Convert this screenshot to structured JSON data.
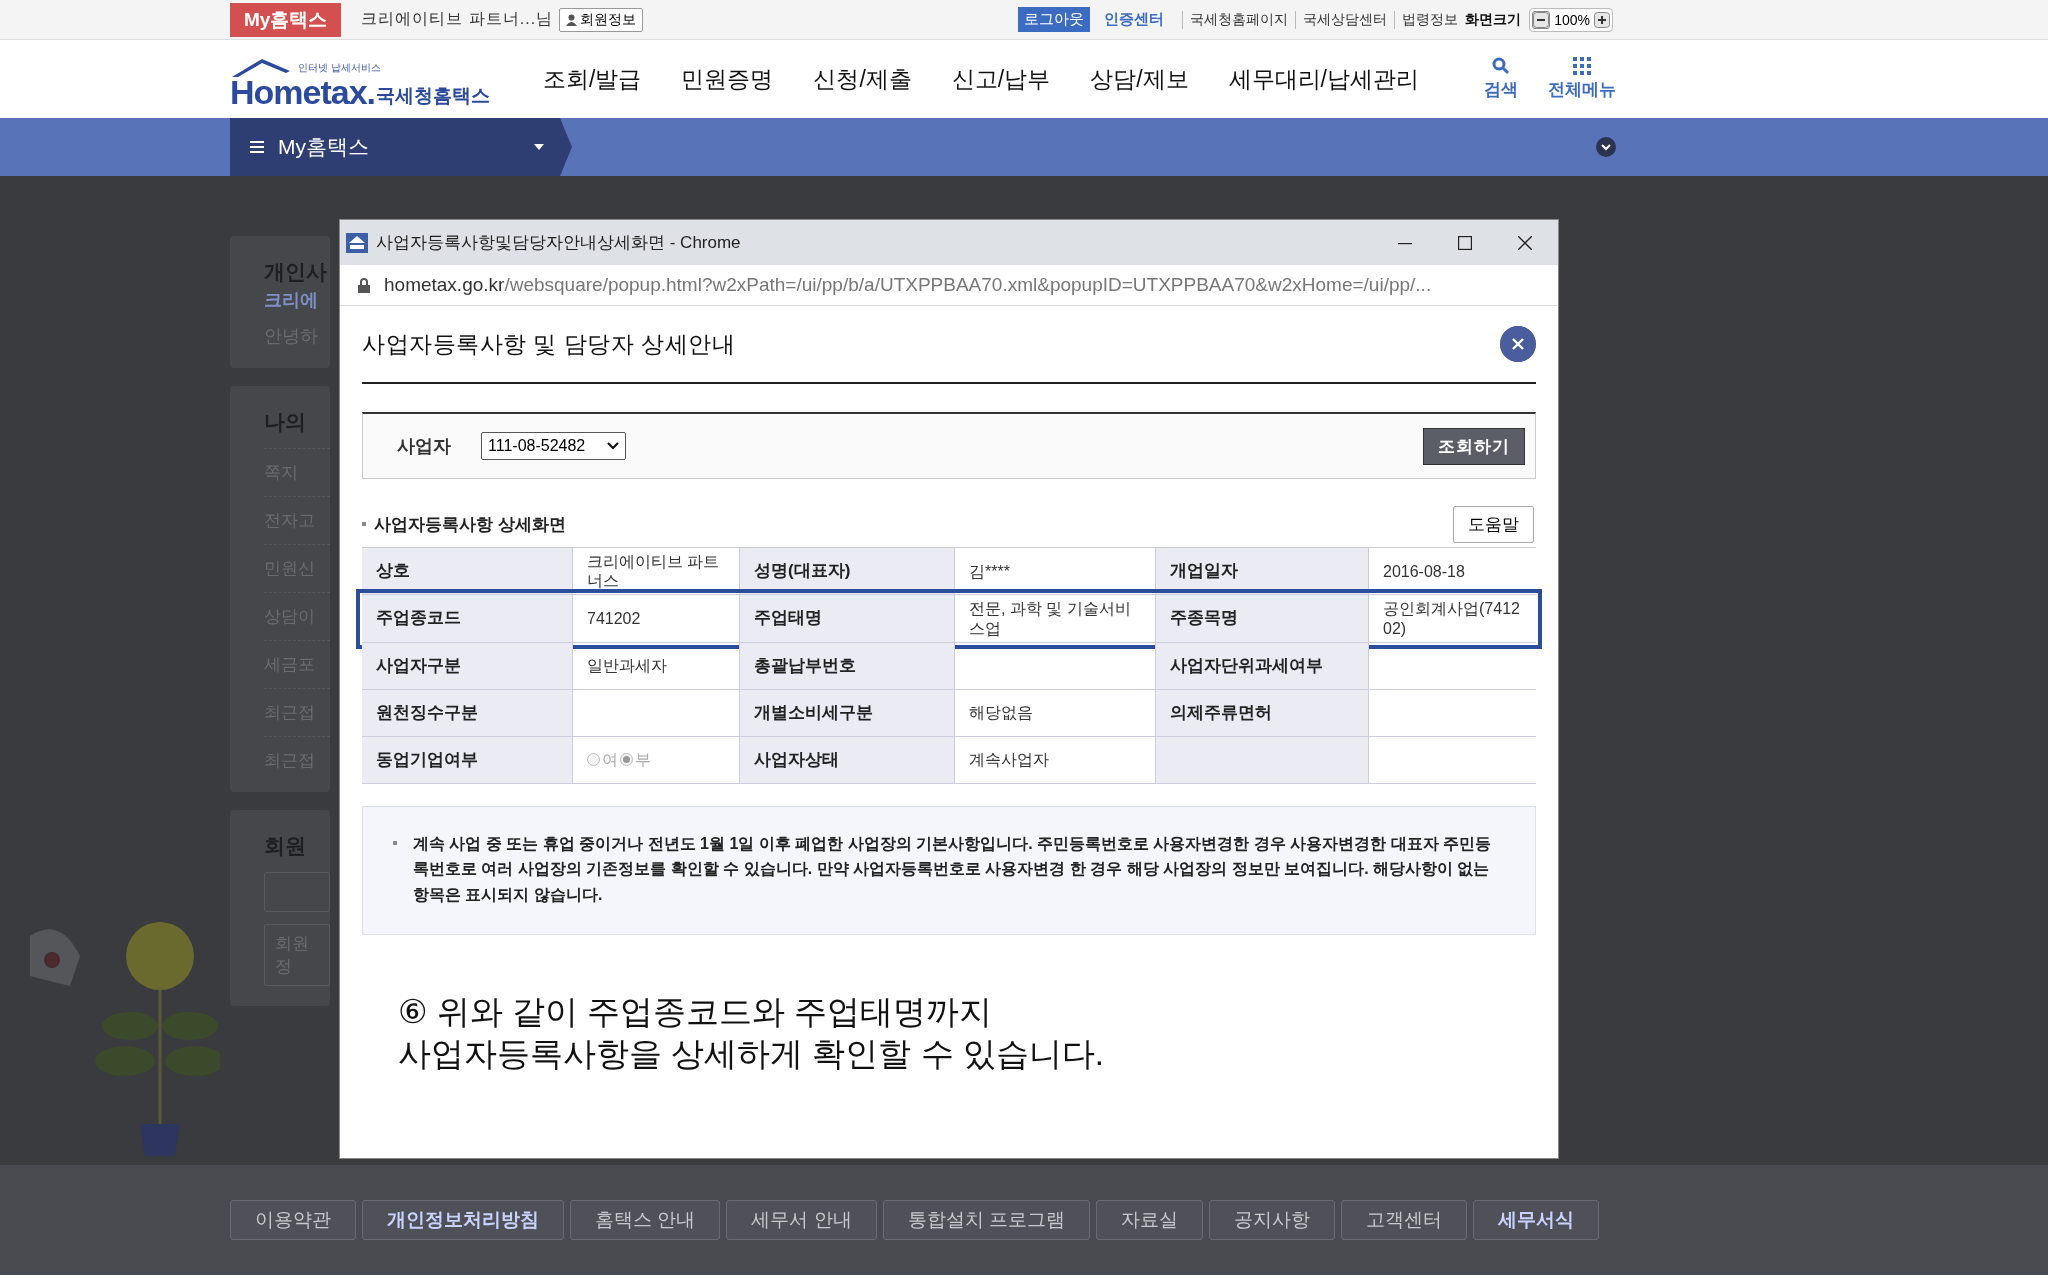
{
  "top_bar": {
    "my_button": "My홈택스",
    "user": "크리에이티브 파트너...님",
    "member_info": "회원정보",
    "logout": "로그아웃",
    "cert_center": "인증센터",
    "links": [
      "국세청홈페이지",
      "국세상담센터",
      "법령정보"
    ],
    "zoom_label": "화면크기",
    "zoom_value": "100%"
  },
  "header": {
    "logo_tagline": "인터넷 납세서비스",
    "logo": "Hometax.",
    "logo_name": "국세청홈택스",
    "menu": [
      "조회/발급",
      "민원증명",
      "신청/제출",
      "신고/납부",
      "상담/제보",
      "세무대리/납세관리"
    ],
    "search": "검색",
    "all_menu": "전체메뉴"
  },
  "nav_bar": {
    "title": "My홈택스"
  },
  "background": {
    "cards": [
      {
        "lines": [
          {
            "kind": "title",
            "text": "개인사"
          },
          {
            "kind": "link",
            "text": "크리에"
          },
          {
            "kind": "text",
            "text": "안녕하"
          }
        ]
      },
      {
        "lines": [
          {
            "kind": "title",
            "text": "나의"
          },
          {
            "kind": "item",
            "text": "쪽지"
          },
          {
            "kind": "item",
            "text": "전자고"
          },
          {
            "kind": "item",
            "text": "민원신"
          },
          {
            "kind": "item",
            "text": "상담이"
          },
          {
            "kind": "item",
            "text": "세금포"
          },
          {
            "kind": "item",
            "text": "최근접"
          },
          {
            "kind": "item",
            "text": "최근접"
          }
        ]
      },
      {
        "lines": [
          {
            "kind": "title",
            "text": "회원"
          },
          {
            "kind": "field"
          },
          {
            "kind": "button",
            "text": "회원정"
          }
        ]
      }
    ]
  },
  "popup": {
    "window_title": "사업자등록사항및담당자안내상세화면 - Chrome",
    "url_host": "hometax.go.kr",
    "url_path": "/websquare/popup.html?w2xPath=/ui/pp/b/a/UTXPPBAA70.xml&popupID=UTXPPBAA70&w2xHome=/ui/pp/...",
    "heading": "사업자등록사항 및 담당자 상세안내",
    "search": {
      "label": "사업자",
      "value": "111-08-52482",
      "button": "조회하기"
    },
    "section_title": "사업자등록사항 상세화면",
    "help_button": "도움말",
    "table": {
      "rows": [
        {
          "highlighted": false,
          "cells": [
            {
              "kind": "label",
              "text": "상호"
            },
            {
              "kind": "value",
              "text": "크리에이티브 파트너스"
            },
            {
              "kind": "label",
              "text": "성명(대표자)"
            },
            {
              "kind": "value",
              "text": "김****"
            },
            {
              "kind": "label",
              "text": "개업일자"
            },
            {
              "kind": "value",
              "text": "2016-08-18"
            }
          ]
        },
        {
          "highlighted": true,
          "cells": [
            {
              "kind": "label",
              "text": "주업종코드"
            },
            {
              "kind": "value",
              "text": "741202"
            },
            {
              "kind": "label",
              "text": "주업태명"
            },
            {
              "kind": "value",
              "text": "전문, 과학 및 기술서비스업"
            },
            {
              "kind": "label",
              "text": "주종목명"
            },
            {
              "kind": "value",
              "text": "공인회계사업(741202)"
            }
          ]
        },
        {
          "highlighted": false,
          "cells": [
            {
              "kind": "label",
              "text": "사업자구분"
            },
            {
              "kind": "value",
              "text": "일반과세자"
            },
            {
              "kind": "label",
              "text": "총괄납부번호"
            },
            {
              "kind": "value"
            },
            {
              "kind": "label",
              "text": "사업자단위과세여부"
            },
            {
              "kind": "value"
            }
          ]
        },
        {
          "highlighted": false,
          "cells": [
            {
              "kind": "label",
              "text": "원천징수구분"
            },
            {
              "kind": "value"
            },
            {
              "kind": "label",
              "text": "개별소비세구분"
            },
            {
              "kind": "value",
              "text": "해당없음"
            },
            {
              "kind": "label",
              "text": "의제주류면허"
            },
            {
              "kind": "value"
            }
          ]
        },
        {
          "highlighted": false,
          "cells": [
            {
              "kind": "label",
              "text": "동업기업여부"
            },
            {
              "kind": "radio",
              "disabled": true,
              "options": [
                {
                  "label": "여",
                  "selected": false
                },
                {
                  "label": "부",
                  "selected": true
                }
              ]
            },
            {
              "kind": "label",
              "text": "사업자상태"
            },
            {
              "kind": "value",
              "text": "계속사업자"
            },
            {
              "kind": "label"
            },
            {
              "kind": "value"
            }
          ]
        }
      ]
    },
    "note": "계속 사업 중 또는 휴업 중이거나 전년도 1월 1일 이후 폐업한 사업장의 기본사항입니다. 주민등록번호로 사용자변경한 경우 사용자변경한 대표자 주민등록번호로 여러 사업장의 기존정보를 확인할 수 있습니다. 만약 사업자등록번호로 사용자변경 한 경우 해당 사업장의 정보만 보여집니다. 해당사항이 없는 항목은 표시되지 않습니다.",
    "caption": [
      "⑥ 위와 같이 주업종코드와 주업태명까지",
      "사업자등록사항을 상세하게 확인할 수 있습니다."
    ]
  },
  "footer": {
    "links": [
      {
        "label": "이용약관",
        "emphasis": false
      },
      {
        "label": "개인정보처리방침",
        "emphasis": true
      },
      {
        "label": "홈택스 안내",
        "emphasis": false
      },
      {
        "label": "세무서 안내",
        "emphasis": false
      },
      {
        "label": "통합설치 프로그램",
        "emphasis": false
      },
      {
        "label": "자료실",
        "emphasis": false
      },
      {
        "label": "공지사항",
        "emphasis": false
      },
      {
        "label": "고객센터",
        "emphasis": false
      },
      {
        "label": "세무서식",
        "emphasis": true
      }
    ]
  }
}
